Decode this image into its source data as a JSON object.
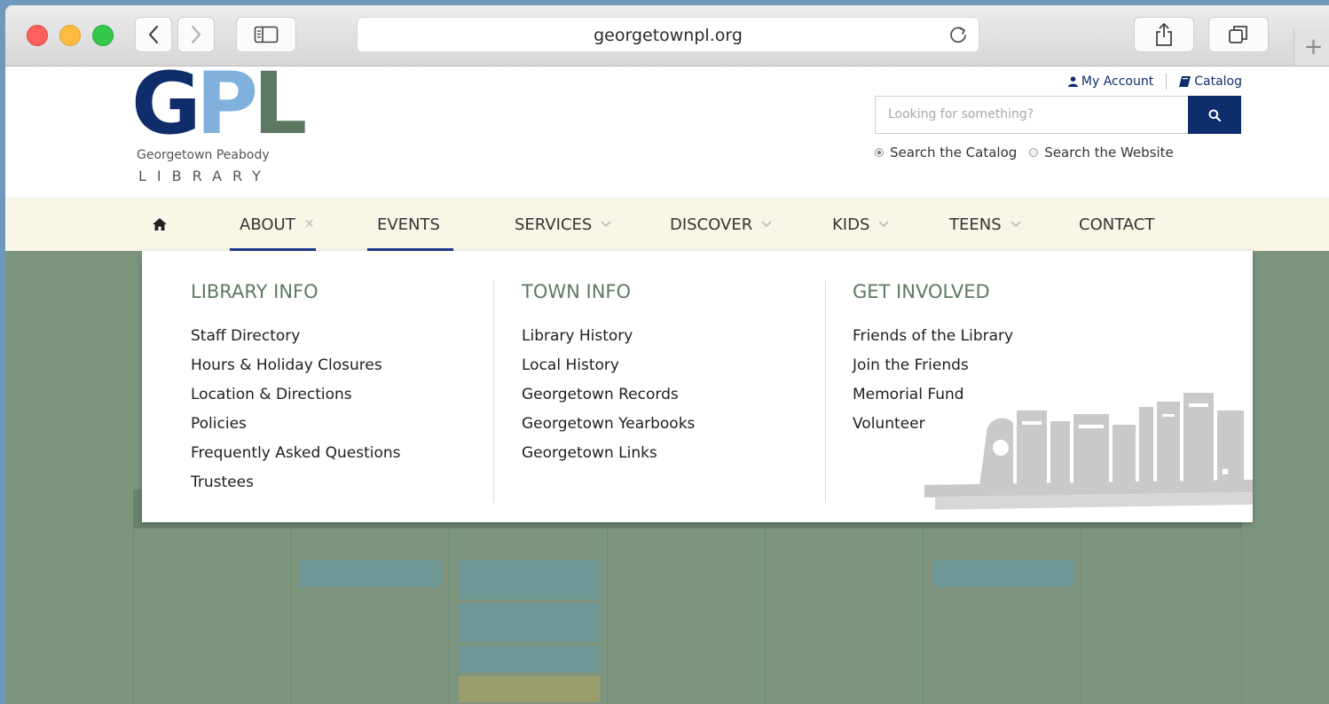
{
  "browser": {
    "url": "georgetownpl.org",
    "newtab_label": "+"
  },
  "header": {
    "logo": {
      "letters": [
        "G",
        "P",
        "L"
      ],
      "subtitle": "Georgetown Peabody",
      "library_word": "LIBRARY"
    },
    "utility_links": {
      "account": "My Account",
      "catalog": "Catalog"
    },
    "search": {
      "placeholder": "Looking for something?",
      "options": [
        "Search the Catalog",
        "Search the Website"
      ],
      "selected": "Search the Catalog"
    }
  },
  "nav": {
    "items": [
      {
        "label": "",
        "icon": "home-icon"
      },
      {
        "label": "ABOUT",
        "icon": "close-icon",
        "active": true
      },
      {
        "label": "EVENTS",
        "active": true
      },
      {
        "label": "SERVICES",
        "icon": "chevron-down-icon"
      },
      {
        "label": "DISCOVER",
        "icon": "chevron-down-icon"
      },
      {
        "label": "KIDS",
        "icon": "chevron-down-icon"
      },
      {
        "label": "TEENS",
        "icon": "chevron-down-icon"
      },
      {
        "label": "CONTACT"
      }
    ],
    "accent_color": "#1b3a8a"
  },
  "mega_menu": {
    "columns": [
      {
        "title": "LIBRARY INFO",
        "links": [
          "Staff Directory",
          "Hours & Holiday Closures",
          "Location & Directions",
          "Policies",
          "Frequently Asked Questions",
          "Trustees"
        ]
      },
      {
        "title": "TOWN INFO",
        "links": [
          "Library History",
          "Local History",
          "Georgetown Records",
          "Georgetown Yearbooks",
          "Georgetown Links"
        ]
      },
      {
        "title": "GET INVOLVED",
        "links": [
          "Friends of the Library",
          "Join the Friends",
          "Memorial Fund",
          "Volunteer"
        ]
      }
    ],
    "title_color": "#5d7a60"
  },
  "colors": {
    "brand_navy": "#0f2d6b",
    "brand_light_blue": "#7fb1dc",
    "brand_green": "#5d7a60",
    "nav_background": "#f9f6e8",
    "overlay_background": "#7d957f"
  }
}
